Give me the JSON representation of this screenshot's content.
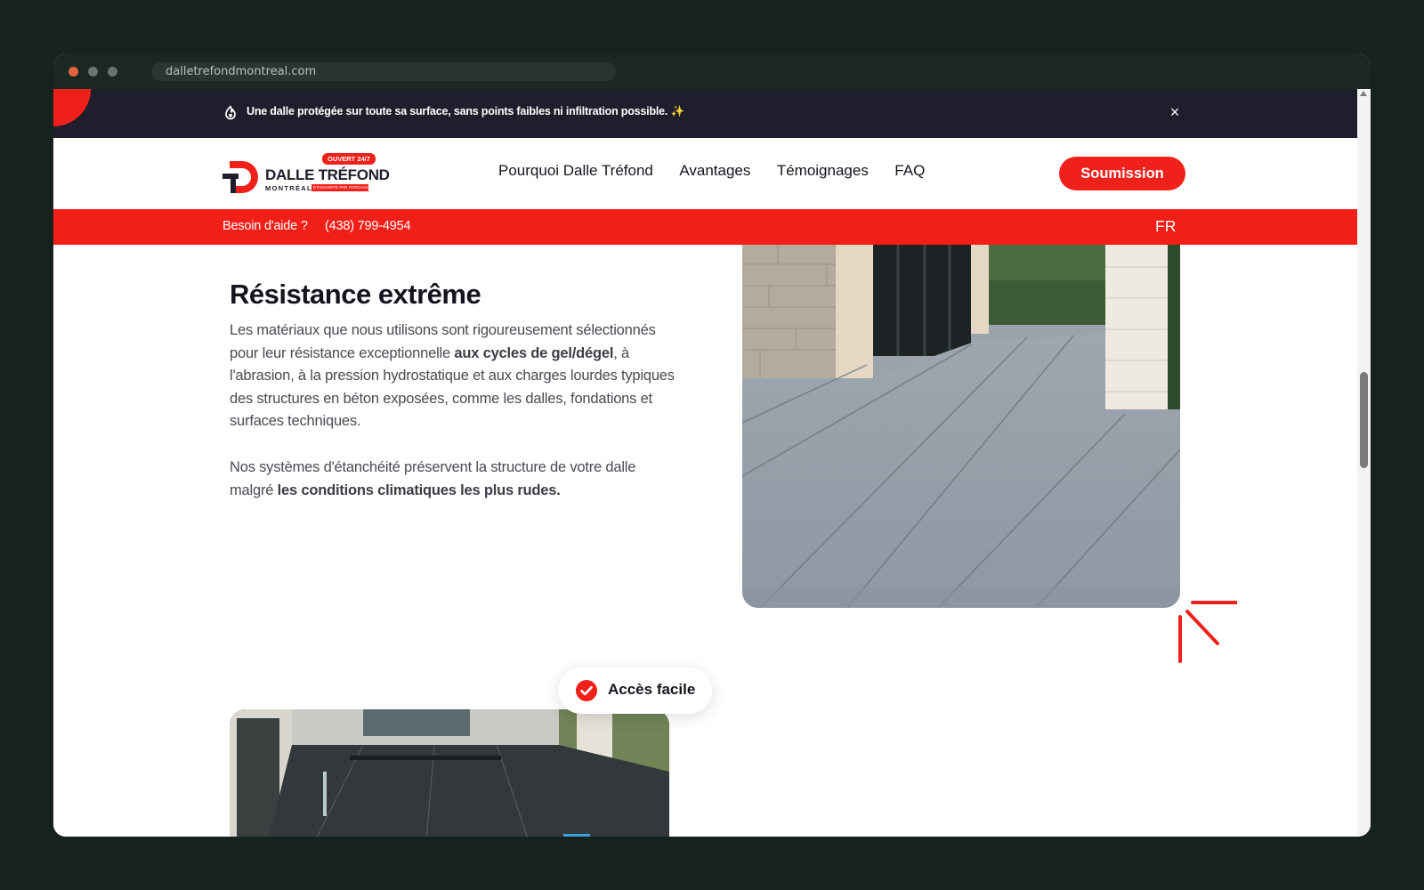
{
  "browser": {
    "url": "dalletrefondmontreal.com"
  },
  "announcement": {
    "text": "Une dalle protégée sur toute sa surface, sans points faibles ni infiltration possible. ✨",
    "close_label": "×"
  },
  "logo": {
    "badge": "OUVERT 24/7",
    "name": "DALLE TRÉFOND",
    "city": "MONTRÉAL",
    "strip_text": "ÉTANCHÉITÉ PAR TORCHAGE"
  },
  "nav": {
    "items": [
      {
        "label": "Pourquoi Dalle Tréfond"
      },
      {
        "label": "Avantages"
      },
      {
        "label": "Témoignages"
      },
      {
        "label": "FAQ"
      }
    ],
    "cta_label": "Soumission"
  },
  "helpbar": {
    "label": "Besoin d'aide ?",
    "phone": "(438) 799-4954",
    "language": "FR"
  },
  "section": {
    "title": "Résistance extrême",
    "para1_part1": "Les matériaux que nous utilisons sont rigoureusement sélectionnés pour leur résistance exceptionnelle ",
    "para1_bold": "aux cycles de gel/dégel",
    "para1_part2": ", à l'abrasion, à la pression hydrostatique et aux charges lourdes typiques des structures en béton exposées, comme les dalles, fondations et surfaces techniques.",
    "para2_part1": "Nos systèmes d'étanchéité préservent la structure de votre dalle malgré ",
    "para2_bold": "les conditions climatiques les plus rudes."
  },
  "badge_pill": {
    "label": "Accès facile"
  },
  "colors": {
    "brand_red": "#f0211b",
    "announce_bg": "#1e1e2c",
    "text_dark": "#14141c",
    "text_body": "#4a4a52"
  }
}
